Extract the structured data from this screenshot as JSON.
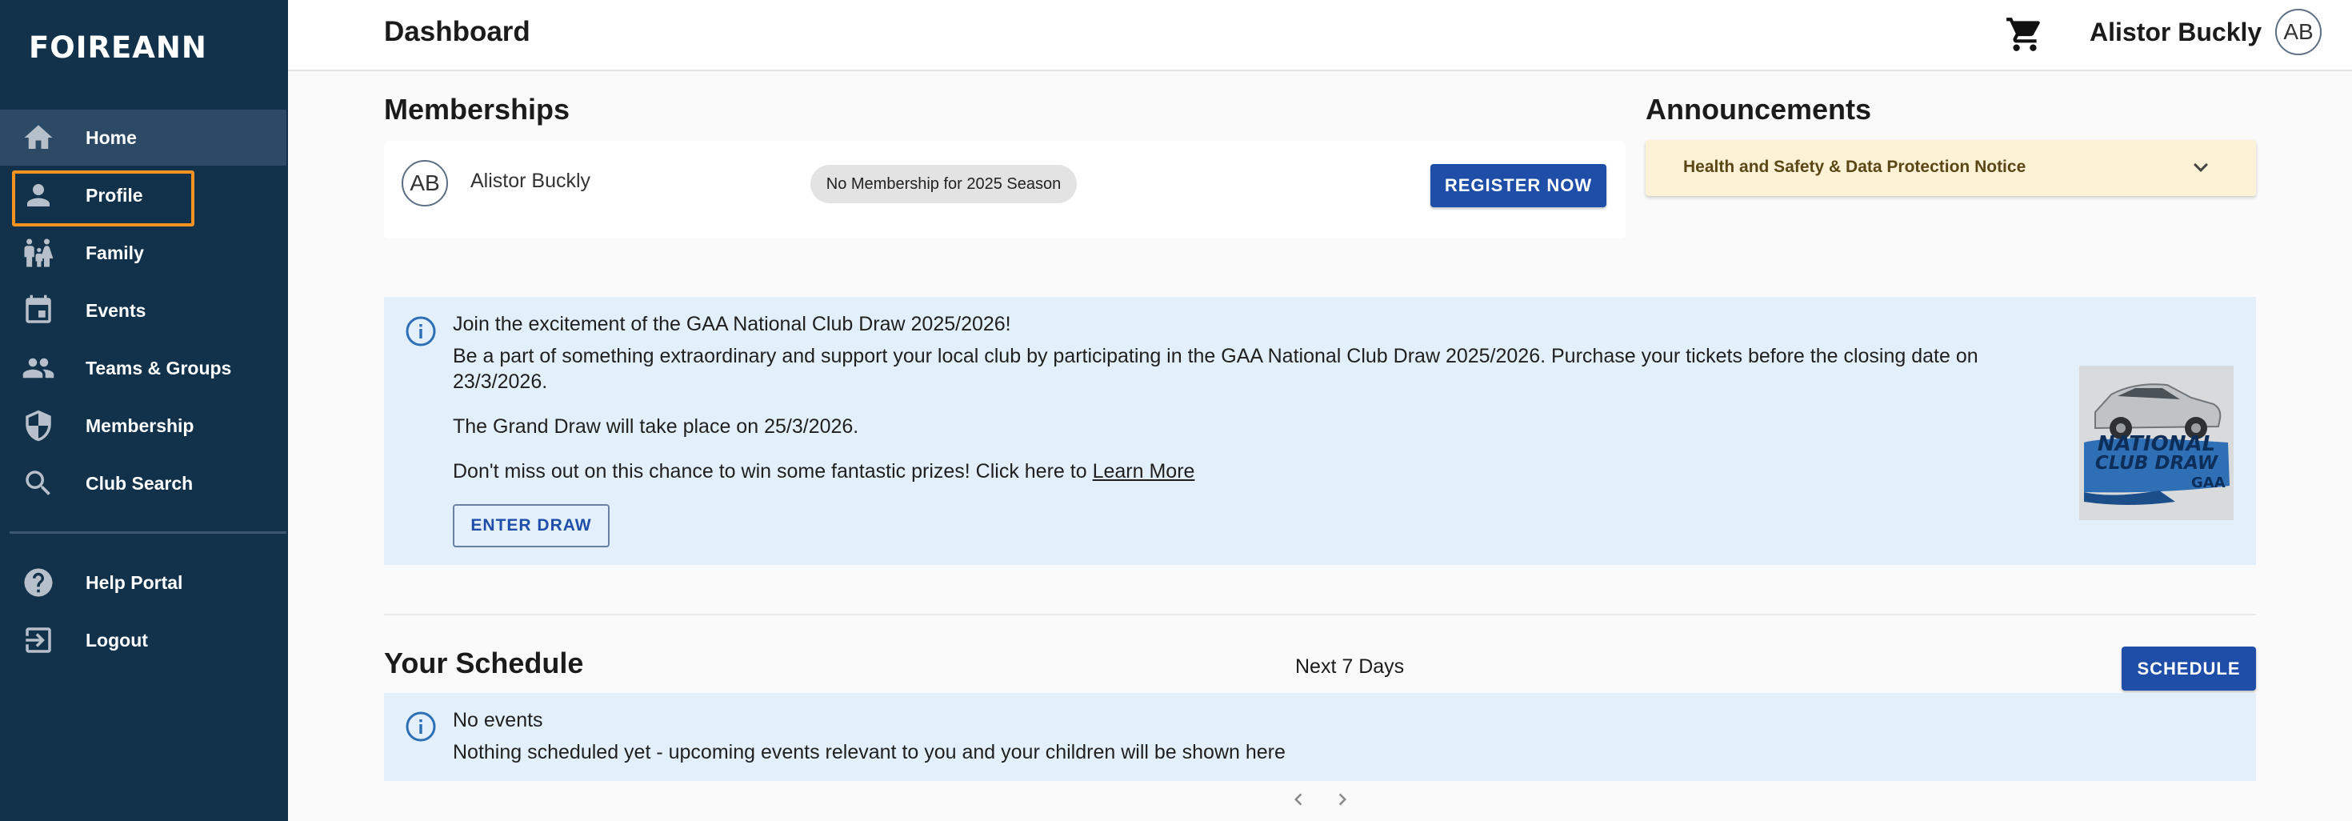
{
  "app": {
    "logo_text": "FOIREANN"
  },
  "sidebar": {
    "items": [
      {
        "label": "Home",
        "icon": "home-icon"
      },
      {
        "label": "Profile",
        "icon": "person-icon"
      },
      {
        "label": "Family",
        "icon": "family-icon"
      },
      {
        "label": "Events",
        "icon": "calendar-icon"
      },
      {
        "label": "Teams & Groups",
        "icon": "group-icon"
      },
      {
        "label": "Membership",
        "icon": "shield-icon"
      },
      {
        "label": "Club Search",
        "icon": "search-icon"
      },
      {
        "label": "Help Portal",
        "icon": "help-icon"
      },
      {
        "label": "Logout",
        "icon": "logout-icon"
      }
    ],
    "active": "Home",
    "highlighted": "Profile"
  },
  "header": {
    "title": "Dashboard",
    "user_name": "Alistor Buckly",
    "avatar_initials": "AB"
  },
  "memberships": {
    "title": "Memberships",
    "member_initials": "AB",
    "member_name": "Alistor Buckly",
    "status": "No Membership for 2025 Season",
    "register_label": "REGISTER NOW"
  },
  "announcements": {
    "title": "Announcements",
    "items": [
      {
        "label": "Health and Safety & Data Protection Notice"
      }
    ]
  },
  "draw_banner": {
    "heading": "Join the excitement of the GAA National Club Draw 2025/2026!",
    "para1_line1": "Be a part of something extraordinary and support your local club by participating in the GAA National Club Draw 2025/2026. Purchase your tickets before the closing date on",
    "para1_line2": "23/3/2026.",
    "para2": "The Grand Draw will take place on 25/3/2026.",
    "para3": "Don't miss out on this chance to win some fantastic prizes! Click here to",
    "link_label": "Learn More",
    "button_label": "ENTER DRAW",
    "image_text_line1": "NATIONAL",
    "image_text_line2": "CLUB DRAW",
    "image_brand": "GAA"
  },
  "schedule": {
    "title": "Your Schedule",
    "range_label": "Next 7 Days",
    "button_label": "SCHEDULE",
    "empty_title": "No events",
    "empty_text": "Nothing scheduled yet - upcoming events relevant to you and your children will be shown here"
  },
  "colors": {
    "sidebar_bg": "#12324b",
    "primary": "#1e4ea8",
    "highlight": "#f4931f",
    "info_bg": "#e3f0fb",
    "announcement_bg": "#fdf2d6"
  }
}
